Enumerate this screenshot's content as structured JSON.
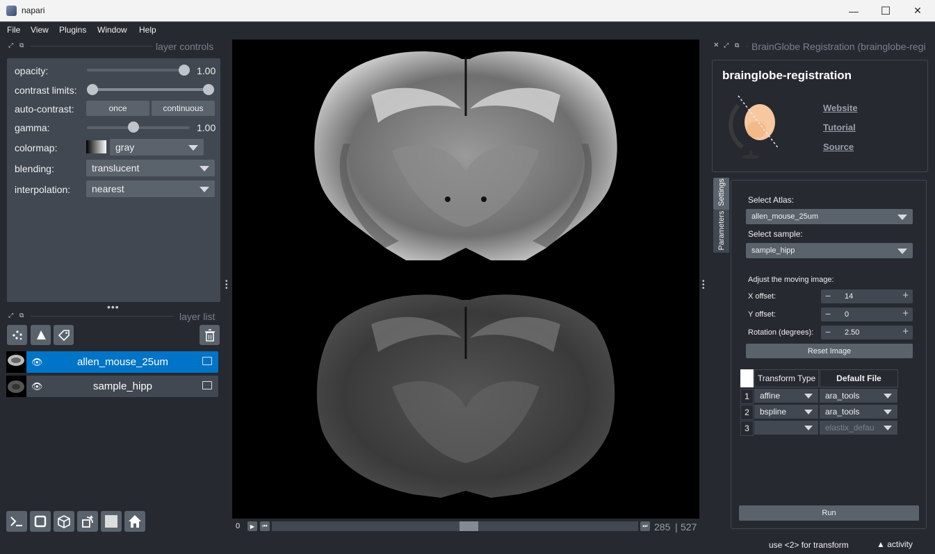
{
  "window": {
    "title": "napari",
    "minimize": "—",
    "maximize": "☐",
    "close": "✕"
  },
  "menu": [
    "File",
    "View",
    "Plugins",
    "Window",
    "Help"
  ],
  "layer_controls": {
    "header": "layer controls",
    "opacity": {
      "label": "opacity:",
      "value": "1.00",
      "level": 1.0
    },
    "contrast_limits": {
      "label": "contrast limits:"
    },
    "auto_contrast": {
      "label": "auto-contrast:",
      "once": "once",
      "continuous": "continuous"
    },
    "gamma": {
      "label": "gamma:",
      "value": "1.00"
    },
    "colormap": {
      "label": "colormap:",
      "value": "gray"
    },
    "blending": {
      "label": "blending:",
      "value": "translucent"
    },
    "interpolation": {
      "label": "interpolation:",
      "value": "nearest"
    }
  },
  "layer_list": {
    "header": "layer list",
    "layers": [
      {
        "name": "allen_mouse_25um",
        "selected": true
      },
      {
        "name": "sample_hipp",
        "selected": false
      }
    ]
  },
  "dims": {
    "play_label": "0",
    "current": "285",
    "total": "527"
  },
  "plugin": {
    "dock_title": "BrainGlobe Registration (brainglobe-regi",
    "header": "brainglobe-registration",
    "links": [
      "Website",
      "Tutorial",
      "Source"
    ],
    "tabs": [
      "Settings",
      "Parameters"
    ],
    "select_atlas_label": "Select Atlas:",
    "atlas_value": "allen_mouse_25um",
    "select_sample_label": "Select sample:",
    "sample_value": "sample_hipp",
    "adjust_label": "Adjust the moving image:",
    "x_offset": {
      "label": "X offset:",
      "value": "14"
    },
    "y_offset": {
      "label": "Y offset:",
      "value": "0"
    },
    "rotation": {
      "label": "Rotation (degrees):",
      "value": "2.50"
    },
    "reset_label": "Reset Image",
    "table": {
      "headers": [
        "Transform Type",
        "Default File"
      ],
      "rows": [
        {
          "idx": "1",
          "type": "affine",
          "file": "ara_tools"
        },
        {
          "idx": "2",
          "type": "bspline",
          "file": "ara_tools"
        },
        {
          "idx": "3",
          "type": "",
          "file": "elastix_defau"
        }
      ]
    },
    "run_label": "Run"
  },
  "status": {
    "hint": "use <2> for transform",
    "activity": "activity"
  }
}
